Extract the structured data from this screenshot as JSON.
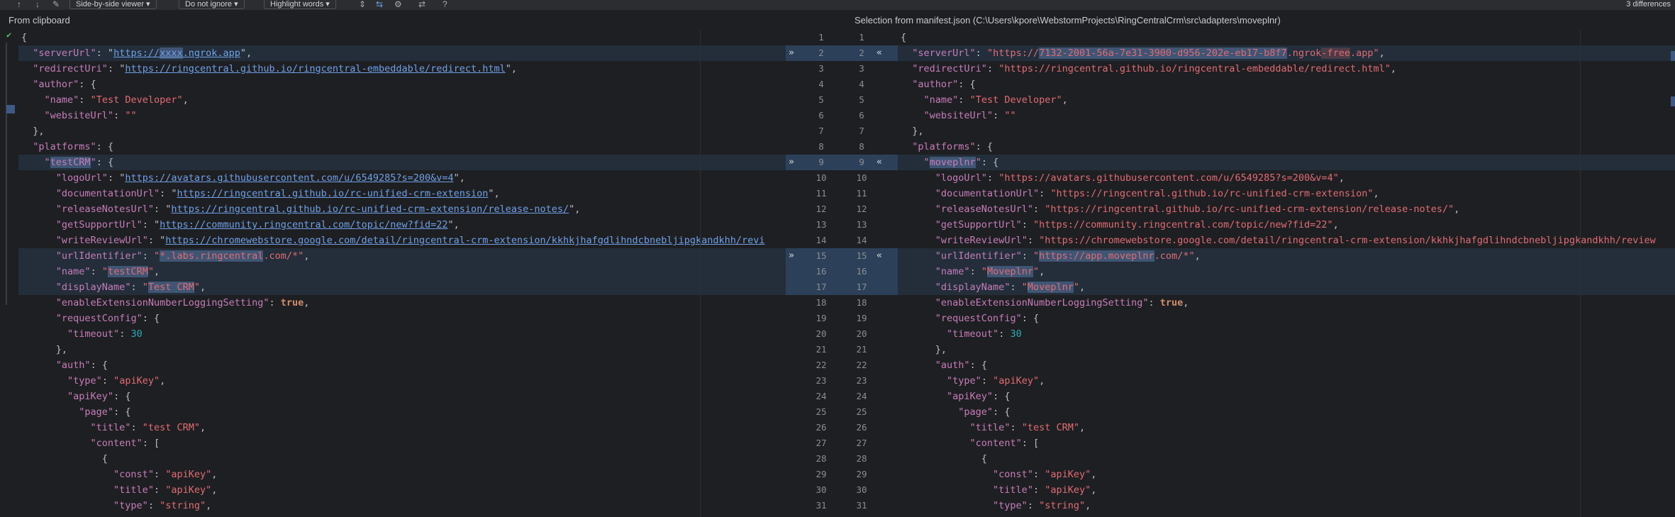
{
  "toolbar": {
    "viewer": "Side-by-side viewer",
    "ignore": "Do not ignore",
    "highlight": "Highlight words",
    "diff_count": "3 differences",
    "icons": [
      "up-arrow-icon",
      "down-arrow-icon",
      "edit-icon",
      "collapse-icon",
      "settings-icon",
      "sync-icon",
      "help-icon"
    ]
  },
  "left_header": "From clipboard",
  "right_header": "Selection from manifest.json (C:\\Users\\kpore\\WebstormProjects\\RingCentralCrm\\src\\adapters\\moveplnr)",
  "left_lines": [
    [
      {
        "c": "p",
        "t": "{"
      }
    ],
    [
      {
        "c": "p",
        "t": "  "
      },
      {
        "c": "k",
        "t": "\"serverUrl\""
      },
      {
        "c": "p",
        "t": ": \""
      },
      {
        "c": "url",
        "t": "https://"
      },
      {
        "c": "url hl",
        "t": "xxxx"
      },
      {
        "c": "url",
        "t": ".ngrok.app"
      },
      {
        "c": "p",
        "t": "\","
      }
    ],
    [
      {
        "c": "p",
        "t": "  "
      },
      {
        "c": "k",
        "t": "\"redirectUri\""
      },
      {
        "c": "p",
        "t": ": \""
      },
      {
        "c": "url",
        "t": "https://ringcentral.github.io/ringcentral-embeddable/redirect.html"
      },
      {
        "c": "p",
        "t": "\","
      }
    ],
    [
      {
        "c": "p",
        "t": "  "
      },
      {
        "c": "k",
        "t": "\"author\""
      },
      {
        "c": "p",
        "t": ": {"
      }
    ],
    [
      {
        "c": "p",
        "t": "    "
      },
      {
        "c": "k",
        "t": "\"name\""
      },
      {
        "c": "p",
        "t": ": "
      },
      {
        "c": "str",
        "t": "\"Test Developer\""
      },
      {
        "c": "p",
        "t": ","
      }
    ],
    [
      {
        "c": "p",
        "t": "    "
      },
      {
        "c": "k",
        "t": "\"websiteUrl\""
      },
      {
        "c": "p",
        "t": ": "
      },
      {
        "c": "str",
        "t": "\"\""
      }
    ],
    [
      {
        "c": "p",
        "t": "  },"
      }
    ],
    [
      {
        "c": "p",
        "t": "  "
      },
      {
        "c": "k",
        "t": "\"platforms\""
      },
      {
        "c": "p",
        "t": ": {"
      }
    ],
    [
      {
        "c": "p",
        "t": "    "
      },
      {
        "c": "k",
        "t": "\""
      },
      {
        "c": "k hl",
        "t": "testCRM"
      },
      {
        "c": "k",
        "t": "\""
      },
      {
        "c": "p",
        "t": ": {"
      }
    ],
    [
      {
        "c": "p",
        "t": "      "
      },
      {
        "c": "k",
        "t": "\"logoUrl\""
      },
      {
        "c": "p",
        "t": ": \""
      },
      {
        "c": "url",
        "t": "https://avatars.githubusercontent.com/u/6549285?s=200&v=4"
      },
      {
        "c": "p",
        "t": "\","
      }
    ],
    [
      {
        "c": "p",
        "t": "      "
      },
      {
        "c": "k",
        "t": "\"documentationUrl\""
      },
      {
        "c": "p",
        "t": ": \""
      },
      {
        "c": "url",
        "t": "https://ringcentral.github.io/rc-unified-crm-extension"
      },
      {
        "c": "p",
        "t": "\","
      }
    ],
    [
      {
        "c": "p",
        "t": "      "
      },
      {
        "c": "k",
        "t": "\"releaseNotesUrl\""
      },
      {
        "c": "p",
        "t": ": \""
      },
      {
        "c": "url",
        "t": "https://ringcentral.github.io/rc-unified-crm-extension/release-notes/"
      },
      {
        "c": "p",
        "t": "\","
      }
    ],
    [
      {
        "c": "p",
        "t": "      "
      },
      {
        "c": "k",
        "t": "\"getSupportUrl\""
      },
      {
        "c": "p",
        "t": ": \""
      },
      {
        "c": "url",
        "t": "https://community.ringcentral.com/topic/new?fid=22"
      },
      {
        "c": "p",
        "t": "\","
      }
    ],
    [
      {
        "c": "p",
        "t": "      "
      },
      {
        "c": "k",
        "t": "\"writeReviewUrl\""
      },
      {
        "c": "p",
        "t": ": \""
      },
      {
        "c": "url",
        "t": "https://chromewebstore.google.com/detail/ringcentral-crm-extension/kkhkjhafgdlihndcbnebljipgkandkhh/revi"
      }
    ],
    [
      {
        "c": "p",
        "t": "      "
      },
      {
        "c": "k",
        "t": "\"urlIdentifier\""
      },
      {
        "c": "p",
        "t": ": "
      },
      {
        "c": "str",
        "t": "\""
      },
      {
        "c": "str hl",
        "t": "*.labs.ringcentral"
      },
      {
        "c": "str",
        "t": ".com/*\""
      },
      {
        "c": "p",
        "t": ","
      }
    ],
    [
      {
        "c": "p",
        "t": "      "
      },
      {
        "c": "k",
        "t": "\"name\""
      },
      {
        "c": "p",
        "t": ": "
      },
      {
        "c": "str",
        "t": "\""
      },
      {
        "c": "str hl",
        "t": "testCRM"
      },
      {
        "c": "str",
        "t": "\""
      },
      {
        "c": "p",
        "t": ","
      }
    ],
    [
      {
        "c": "p",
        "t": "      "
      },
      {
        "c": "k",
        "t": "\"displayName\""
      },
      {
        "c": "p",
        "t": ": "
      },
      {
        "c": "str",
        "t": "\""
      },
      {
        "c": "str hl",
        "t": "Test CRM"
      },
      {
        "c": "str",
        "t": "\""
      },
      {
        "c": "p",
        "t": ","
      }
    ],
    [
      {
        "c": "p",
        "t": "      "
      },
      {
        "c": "k",
        "t": "\"enableExtensionNumberLoggingSetting\""
      },
      {
        "c": "p",
        "t": ": "
      },
      {
        "c": "kw",
        "t": "true"
      },
      {
        "c": "p",
        "t": ","
      }
    ],
    [
      {
        "c": "p",
        "t": "      "
      },
      {
        "c": "k",
        "t": "\"requestConfig\""
      },
      {
        "c": "p",
        "t": ": {"
      }
    ],
    [
      {
        "c": "p",
        "t": "        "
      },
      {
        "c": "k",
        "t": "\"timeout\""
      },
      {
        "c": "p",
        "t": ": "
      },
      {
        "c": "num",
        "t": "30"
      }
    ],
    [
      {
        "c": "p",
        "t": "      },"
      }
    ],
    [
      {
        "c": "p",
        "t": "      "
      },
      {
        "c": "k",
        "t": "\"auth\""
      },
      {
        "c": "p",
        "t": ": {"
      }
    ],
    [
      {
        "c": "p",
        "t": "        "
      },
      {
        "c": "k",
        "t": "\"type\""
      },
      {
        "c": "p",
        "t": ": "
      },
      {
        "c": "str",
        "t": "\"apiKey\""
      },
      {
        "c": "p",
        "t": ","
      }
    ],
    [
      {
        "c": "p",
        "t": "        "
      },
      {
        "c": "k",
        "t": "\"apiKey\""
      },
      {
        "c": "p",
        "t": ": {"
      }
    ],
    [
      {
        "c": "p",
        "t": "          "
      },
      {
        "c": "k",
        "t": "\"page\""
      },
      {
        "c": "p",
        "t": ": {"
      }
    ],
    [
      {
        "c": "p",
        "t": "            "
      },
      {
        "c": "k",
        "t": "\"title\""
      },
      {
        "c": "p",
        "t": ": "
      },
      {
        "c": "str",
        "t": "\"test CRM\""
      },
      {
        "c": "p",
        "t": ","
      }
    ],
    [
      {
        "c": "p",
        "t": "            "
      },
      {
        "c": "k",
        "t": "\"content\""
      },
      {
        "c": "p",
        "t": ": ["
      }
    ],
    [
      {
        "c": "p",
        "t": "              {"
      }
    ],
    [
      {
        "c": "p",
        "t": "                "
      },
      {
        "c": "k",
        "t": "\"const\""
      },
      {
        "c": "p",
        "t": ": "
      },
      {
        "c": "str",
        "t": "\"apiKey\""
      },
      {
        "c": "p",
        "t": ","
      }
    ],
    [
      {
        "c": "p",
        "t": "                "
      },
      {
        "c": "k",
        "t": "\"title\""
      },
      {
        "c": "p",
        "t": ": "
      },
      {
        "c": "str",
        "t": "\"apiKey\""
      },
      {
        "c": "p",
        "t": ","
      }
    ],
    [
      {
        "c": "p",
        "t": "                "
      },
      {
        "c": "k",
        "t": "\"type\""
      },
      {
        "c": "p",
        "t": ": "
      },
      {
        "c": "str",
        "t": "\"string\""
      },
      {
        "c": "p",
        "t": ","
      }
    ]
  ],
  "right_lines": [
    [
      {
        "c": "p",
        "t": "{"
      }
    ],
    [
      {
        "c": "p",
        "t": "  "
      },
      {
        "c": "k",
        "t": "\"serverUrl\""
      },
      {
        "c": "p",
        "t": ": "
      },
      {
        "c": "str",
        "t": "\"https://"
      },
      {
        "c": "str hl",
        "t": "7132-2001-56a-7e31-3900-d956-202e-eb17-b8f7"
      },
      {
        "c": "str",
        "t": ".ngrok"
      },
      {
        "c": "str hl2",
        "t": "-free"
      },
      {
        "c": "str",
        "t": ".app\""
      },
      {
        "c": "p",
        "t": ","
      }
    ],
    [
      {
        "c": "p",
        "t": "  "
      },
      {
        "c": "k",
        "t": "\"redirectUri\""
      },
      {
        "c": "p",
        "t": ": "
      },
      {
        "c": "str",
        "t": "\"https://ringcentral.github.io/ringcentral-embeddable/redirect.html\""
      },
      {
        "c": "p",
        "t": ","
      }
    ],
    [
      {
        "c": "p",
        "t": "  "
      },
      {
        "c": "k",
        "t": "\"author\""
      },
      {
        "c": "p",
        "t": ": {"
      }
    ],
    [
      {
        "c": "p",
        "t": "    "
      },
      {
        "c": "k",
        "t": "\"name\""
      },
      {
        "c": "p",
        "t": ": "
      },
      {
        "c": "str",
        "t": "\"Test Developer\""
      },
      {
        "c": "p",
        "t": ","
      }
    ],
    [
      {
        "c": "p",
        "t": "    "
      },
      {
        "c": "k",
        "t": "\"websiteUrl\""
      },
      {
        "c": "p",
        "t": ": "
      },
      {
        "c": "str",
        "t": "\"\""
      }
    ],
    [
      {
        "c": "p",
        "t": "  },"
      }
    ],
    [
      {
        "c": "p",
        "t": "  "
      },
      {
        "c": "k",
        "t": "\"platforms\""
      },
      {
        "c": "p",
        "t": ": {"
      }
    ],
    [
      {
        "c": "p",
        "t": "    "
      },
      {
        "c": "k",
        "t": "\""
      },
      {
        "c": "k hl",
        "t": "moveplnr"
      },
      {
        "c": "k",
        "t": "\""
      },
      {
        "c": "p",
        "t": ": {"
      }
    ],
    [
      {
        "c": "p",
        "t": "      "
      },
      {
        "c": "k",
        "t": "\"logoUrl\""
      },
      {
        "c": "p",
        "t": ": "
      },
      {
        "c": "str",
        "t": "\"https://avatars.githubusercontent.com/u/6549285?s=200&v=4\""
      },
      {
        "c": "p",
        "t": ","
      }
    ],
    [
      {
        "c": "p",
        "t": "      "
      },
      {
        "c": "k",
        "t": "\"documentationUrl\""
      },
      {
        "c": "p",
        "t": ": "
      },
      {
        "c": "str",
        "t": "\"https://ringcentral.github.io/rc-unified-crm-extension\""
      },
      {
        "c": "p",
        "t": ","
      }
    ],
    [
      {
        "c": "p",
        "t": "      "
      },
      {
        "c": "k",
        "t": "\"releaseNotesUrl\""
      },
      {
        "c": "p",
        "t": ": "
      },
      {
        "c": "str",
        "t": "\"https://ringcentral.github.io/rc-unified-crm-extension/release-notes/\""
      },
      {
        "c": "p",
        "t": ","
      }
    ],
    [
      {
        "c": "p",
        "t": "      "
      },
      {
        "c": "k",
        "t": "\"getSupportUrl\""
      },
      {
        "c": "p",
        "t": ": "
      },
      {
        "c": "str",
        "t": "\"https://community.ringcentral.com/topic/new?fid=22\""
      },
      {
        "c": "p",
        "t": ","
      }
    ],
    [
      {
        "c": "p",
        "t": "      "
      },
      {
        "c": "k",
        "t": "\"writeReviewUrl\""
      },
      {
        "c": "p",
        "t": ": "
      },
      {
        "c": "str",
        "t": "\"https://chromewebstore.google.com/detail/ringcentral-crm-extension/kkhkjhafgdlihndcbnebljipgkandkhh/review"
      }
    ],
    [
      {
        "c": "p",
        "t": "      "
      },
      {
        "c": "k",
        "t": "\"urlIdentifier\""
      },
      {
        "c": "p",
        "t": ": "
      },
      {
        "c": "str",
        "t": "\""
      },
      {
        "c": "str hl",
        "t": "https://app.moveplnr"
      },
      {
        "c": "str",
        "t": ".com/*\""
      },
      {
        "c": "p",
        "t": ","
      }
    ],
    [
      {
        "c": "p",
        "t": "      "
      },
      {
        "c": "k",
        "t": "\"name\""
      },
      {
        "c": "p",
        "t": ": "
      },
      {
        "c": "str",
        "t": "\""
      },
      {
        "c": "str hl",
        "t": "Moveplnr"
      },
      {
        "c": "str",
        "t": "\""
      },
      {
        "c": "p",
        "t": ","
      }
    ],
    [
      {
        "c": "p",
        "t": "      "
      },
      {
        "c": "k",
        "t": "\"displayName\""
      },
      {
        "c": "p",
        "t": ": "
      },
      {
        "c": "str",
        "t": "\""
      },
      {
        "c": "str hl",
        "t": "Moveplnr"
      },
      {
        "c": "str",
        "t": "\""
      },
      {
        "c": "p",
        "t": ","
      }
    ],
    [
      {
        "c": "p",
        "t": "      "
      },
      {
        "c": "k",
        "t": "\"enableExtensionNumberLoggingSetting\""
      },
      {
        "c": "p",
        "t": ": "
      },
      {
        "c": "kw",
        "t": "true"
      },
      {
        "c": "p",
        "t": ","
      }
    ],
    [
      {
        "c": "p",
        "t": "      "
      },
      {
        "c": "k",
        "t": "\"requestConfig\""
      },
      {
        "c": "p",
        "t": ": {"
      }
    ],
    [
      {
        "c": "p",
        "t": "        "
      },
      {
        "c": "k",
        "t": "\"timeout\""
      },
      {
        "c": "p",
        "t": ": "
      },
      {
        "c": "num",
        "t": "30"
      }
    ],
    [
      {
        "c": "p",
        "t": "      },"
      }
    ],
    [
      {
        "c": "p",
        "t": "      "
      },
      {
        "c": "k",
        "t": "\"auth\""
      },
      {
        "c": "p",
        "t": ": {"
      }
    ],
    [
      {
        "c": "p",
        "t": "        "
      },
      {
        "c": "k",
        "t": "\"type\""
      },
      {
        "c": "p",
        "t": ": "
      },
      {
        "c": "str",
        "t": "\"apiKey\""
      },
      {
        "c": "p",
        "t": ","
      }
    ],
    [
      {
        "c": "p",
        "t": "        "
      },
      {
        "c": "k",
        "t": "\"apiKey\""
      },
      {
        "c": "p",
        "t": ": {"
      }
    ],
    [
      {
        "c": "p",
        "t": "          "
      },
      {
        "c": "k",
        "t": "\"page\""
      },
      {
        "c": "p",
        "t": ": {"
      }
    ],
    [
      {
        "c": "p",
        "t": "            "
      },
      {
        "c": "k",
        "t": "\"title\""
      },
      {
        "c": "p",
        "t": ": "
      },
      {
        "c": "str",
        "t": "\"test CRM\""
      },
      {
        "c": "p",
        "t": ","
      }
    ],
    [
      {
        "c": "p",
        "t": "            "
      },
      {
        "c": "k",
        "t": "\"content\""
      },
      {
        "c": "p",
        "t": ": ["
      }
    ],
    [
      {
        "c": "p",
        "t": "              {"
      }
    ],
    [
      {
        "c": "p",
        "t": "                "
      },
      {
        "c": "k",
        "t": "\"const\""
      },
      {
        "c": "p",
        "t": ": "
      },
      {
        "c": "str",
        "t": "\"apiKey\""
      },
      {
        "c": "p",
        "t": ","
      }
    ],
    [
      {
        "c": "p",
        "t": "                "
      },
      {
        "c": "k",
        "t": "\"title\""
      },
      {
        "c": "p",
        "t": ": "
      },
      {
        "c": "str",
        "t": "\"apiKey\""
      },
      {
        "c": "p",
        "t": ","
      }
    ],
    [
      {
        "c": "p",
        "t": "                "
      },
      {
        "c": "k",
        "t": "\"type\""
      },
      {
        "c": "p",
        "t": ": "
      },
      {
        "c": "str",
        "t": "\"string\""
      },
      {
        "c": "p",
        "t": ","
      }
    ]
  ],
  "line_numbers": [
    "1",
    "2",
    "3",
    "4",
    "5",
    "6",
    "7",
    "8",
    "9",
    "10",
    "11",
    "12",
    "13",
    "14",
    "15",
    "16",
    "17",
    "18",
    "19",
    "20",
    "21",
    "22",
    "23",
    "24",
    "25",
    "26",
    "27",
    "28",
    "29",
    "30",
    "31"
  ],
  "changed_blocks": [
    [
      2,
      2
    ],
    [
      9,
      9
    ],
    [
      15,
      17
    ]
  ],
  "apply_left_glyph": "»",
  "apply_right_glyph": "«"
}
